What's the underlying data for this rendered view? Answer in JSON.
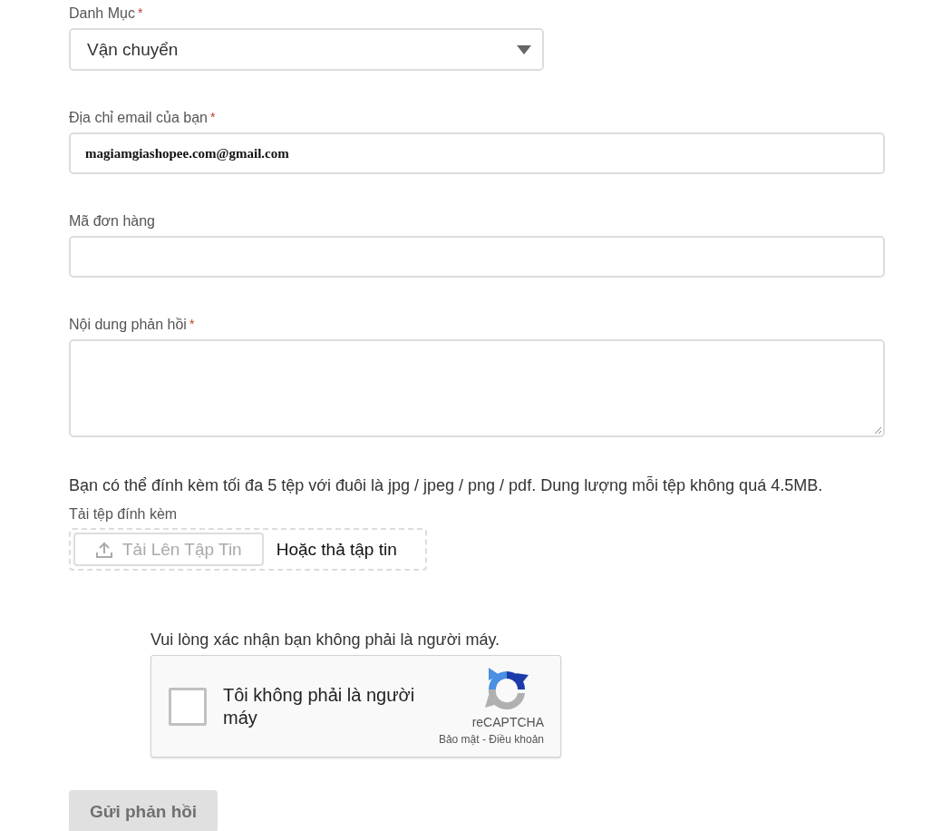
{
  "fields": [
    {
      "kind": "select",
      "label": "Danh Mục",
      "mark": "*",
      "value": "Vận chuyển"
    },
    {
      "kind": "input",
      "label": "Địa chỉ email của bạn",
      "mark": "*",
      "value": "magiamgiashopee.com@gmail.com"
    },
    {
      "kind": "input",
      "label": "Mã đơn hàng"
    },
    {
      "kind": "textarea",
      "label": "Nội dung phản hồi",
      "mark": "*"
    }
  ],
  "attachments": {
    "note": "Bạn có thể đính kèm tối đa 5 tệp với đuôi là jpg / jpeg / png / pdf. Dung lượng mỗi tệp không quá 4.5MB.",
    "label": "Tải tệp đính kèm",
    "upload_button": "Tải Lên Tập Tin",
    "drop_hint": "Hoặc thả tập tin"
  },
  "captcha": {
    "prompt": "Vui lòng xác nhận bạn không phải là người máy.",
    "checkbox_label": "Tôi không phải là người máy",
    "checked": false,
    "brand": "reCAPTCHA",
    "links": "Bảo mật - Điều khoản"
  },
  "submit": {
    "label": "Gửi phản hồi",
    "disabled": true
  }
}
